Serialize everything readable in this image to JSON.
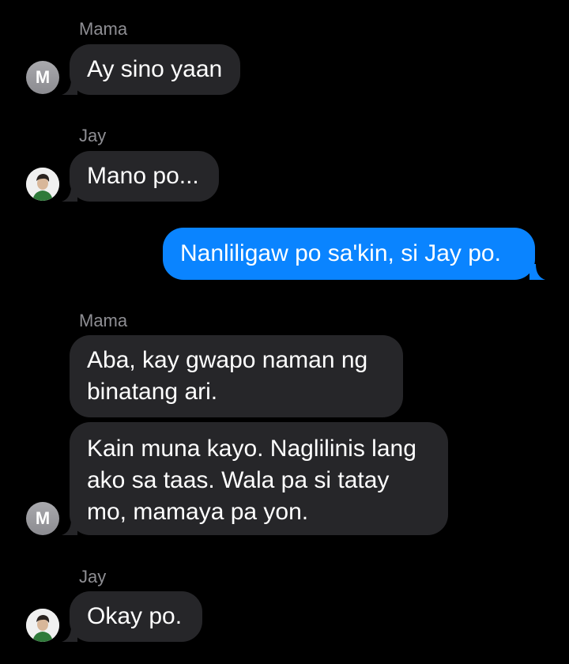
{
  "messages": [
    {
      "sender": "Mama",
      "text": "Ay sino yaan",
      "direction": "incoming",
      "avatar_initial": "M"
    },
    {
      "sender": "Jay",
      "text": "Mano po...",
      "direction": "incoming"
    },
    {
      "text": "Nanliligaw po sa'kin, si Jay po.",
      "direction": "outgoing"
    },
    {
      "sender": "Mama",
      "text": "Aba, kay gwapo naman ng\nbinatang ari.",
      "direction": "incoming"
    },
    {
      "text": "Kain muna kayo. Naglilinis lang\nako sa taas. Wala pa si tatay\nmo, mamaya pa yon.",
      "direction": "incoming",
      "avatar_initial": "M"
    },
    {
      "sender": "Jay",
      "text": "Okay po.",
      "direction": "incoming"
    }
  ],
  "colors": {
    "background": "#000000",
    "incoming_bubble": "#262629",
    "outgoing_bubble": "#0a84ff",
    "sender_name": "#8e8e93"
  }
}
